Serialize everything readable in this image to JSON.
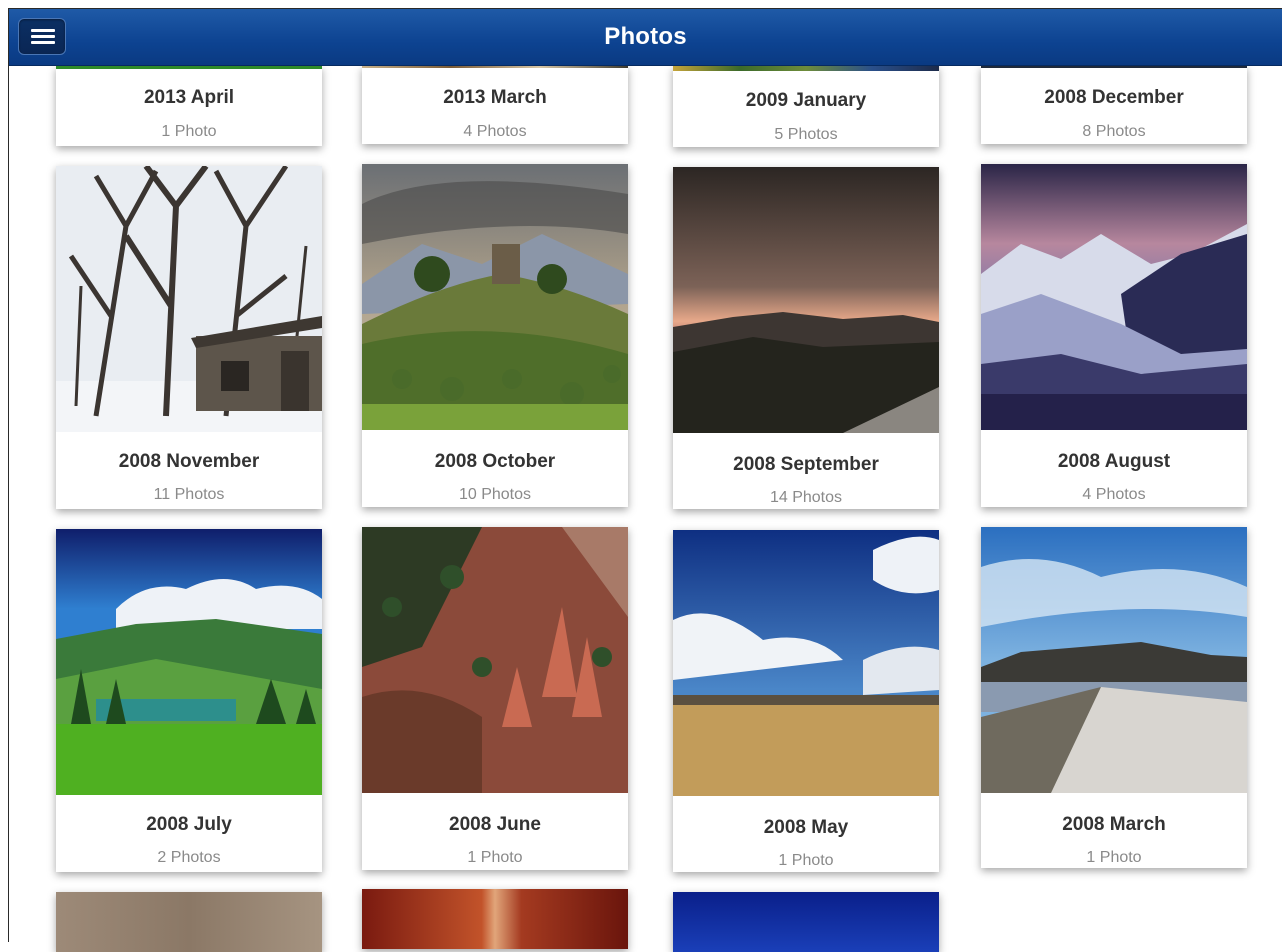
{
  "header": {
    "title": "Photos",
    "menu_icon": "hamburger-menu-icon"
  },
  "albums": [
    {
      "title": "2013 April",
      "count": "1 Photo"
    },
    {
      "title": "2013 March",
      "count": "4 Photos"
    },
    {
      "title": "2009 January",
      "count": "5 Photos"
    },
    {
      "title": "2008 December",
      "count": "8 Photos"
    },
    {
      "title": "2008 November",
      "count": "11 Photos"
    },
    {
      "title": "2008 October",
      "count": "10 Photos"
    },
    {
      "title": "2008 September",
      "count": "14 Photos"
    },
    {
      "title": "2008 August",
      "count": "4 Photos"
    },
    {
      "title": "2008 July",
      "count": "2 Photos"
    },
    {
      "title": "2008 June",
      "count": "1 Photo"
    },
    {
      "title": "2008 May",
      "count": "1 Photo"
    },
    {
      "title": "2008 March",
      "count": "1 Photo"
    }
  ]
}
